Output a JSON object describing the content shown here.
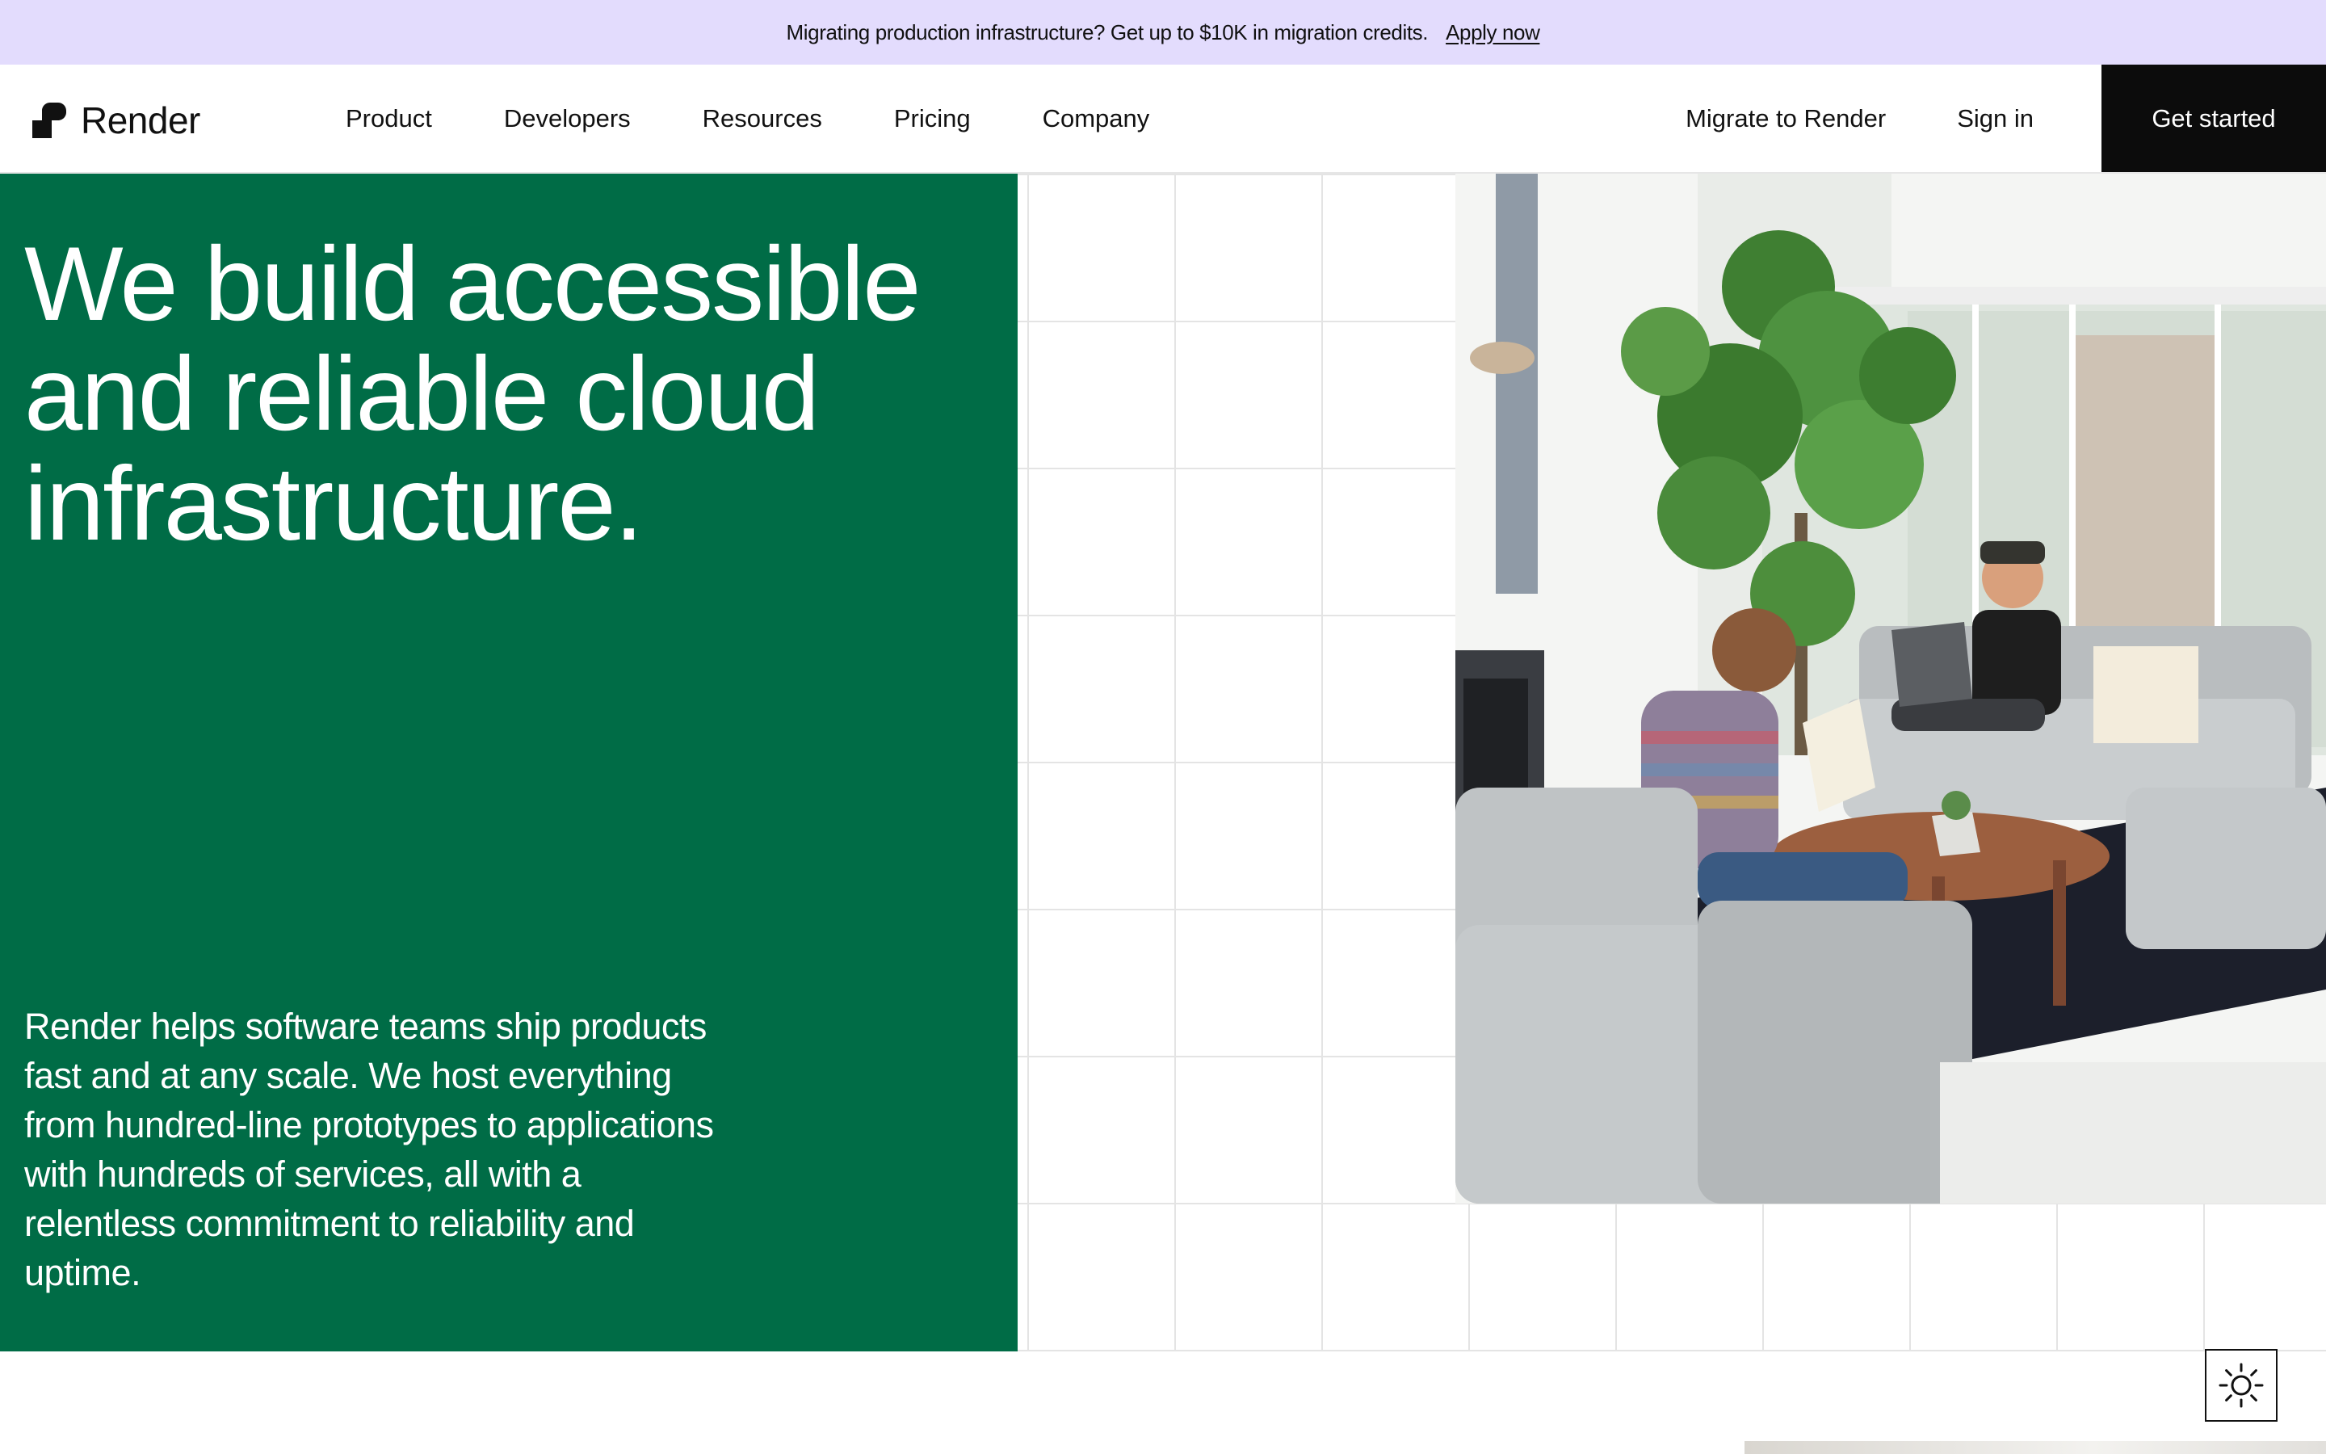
{
  "banner": {
    "text": "Migrating production infrastructure? Get up to $10K in migration credits.",
    "link": "Apply now"
  },
  "nav": {
    "logo": "Render",
    "links": [
      "Product",
      "Developers",
      "Resources",
      "Pricing",
      "Company"
    ],
    "migrate": "Migrate to Render",
    "signin": "Sign in",
    "cta": "Get started"
  },
  "hero": {
    "headline": "We build accessible and reliable cloud infrastructure.",
    "description": "Render helps software teams ship products fast and at any scale. We host everything from hundred-line prototypes to applications with hundreds of services, all with a relentless commitment to reliability and uptime.",
    "image_icon": "office-lounge-photo"
  },
  "theme_toggle": {
    "icon": "sun-icon"
  },
  "colors": {
    "banner_bg": "#e3dcfd",
    "hero_green": "#006c46",
    "cta_bg": "#0c0c0c",
    "grid_line": "#e4e4e4"
  }
}
